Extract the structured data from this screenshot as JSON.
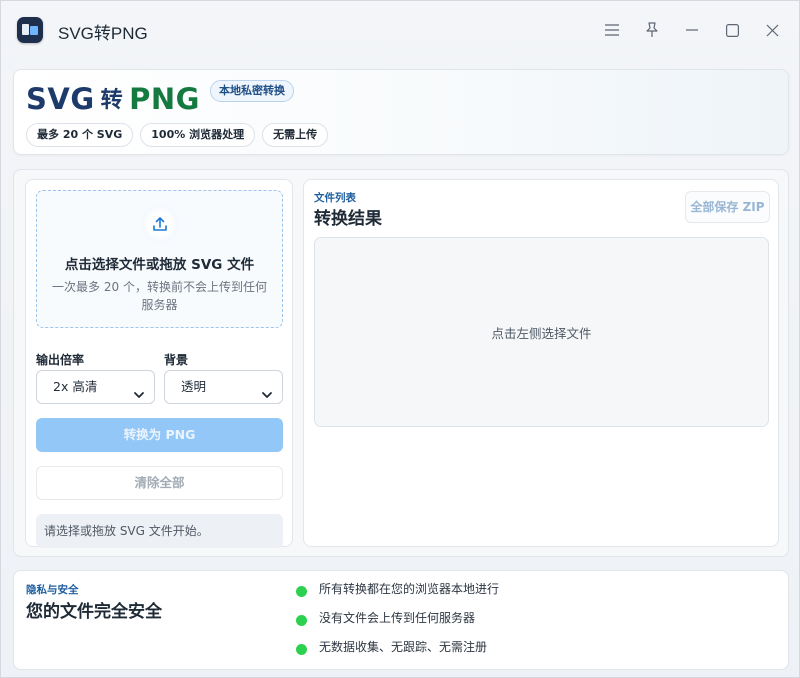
{
  "window": {
    "title": "SVG转PNG",
    "controls": [
      "menu-icon",
      "pin-icon",
      "minimize-icon",
      "maximize-icon",
      "close-icon"
    ]
  },
  "header": {
    "brand_svg": "SVG",
    "brand_to": "转",
    "brand_png": "PNG",
    "badge": "本地私密转换",
    "chips": [
      "最多 20 个 SVG",
      "100% 浏览器处理",
      "无需上传"
    ]
  },
  "dropzone": {
    "title": "点击选择文件或拖放 SVG 文件",
    "subtitle": "一次最多 20 个，转换前不会上传到任何服务器"
  },
  "options": {
    "scale_label": "输出倍率",
    "scale_value": "2x 高清",
    "background_label": "背景",
    "background_value": "透明"
  },
  "actions": {
    "convert": "转换为 PNG",
    "clear": "清除全部"
  },
  "status": "请选择或拖放 SVG 文件开始。",
  "results": {
    "kicker": "文件列表",
    "title": "转换结果",
    "zip_button": "全部保存 ZIP",
    "empty_text": "点击左侧选择文件"
  },
  "privacy": {
    "kicker": "隐私与安全",
    "title": "您的文件完全安全",
    "items": [
      "所有转换都在您的浏览器本地进行",
      "没有文件会上传到任何服务器",
      "无数据收集、无跟踪、无需注册"
    ]
  },
  "colors": {
    "brand_dark": "#1d3a6b",
    "brand_green": "#147a3f",
    "primary_disabled": "#93c7f7",
    "status_green": "#2bd14f"
  }
}
